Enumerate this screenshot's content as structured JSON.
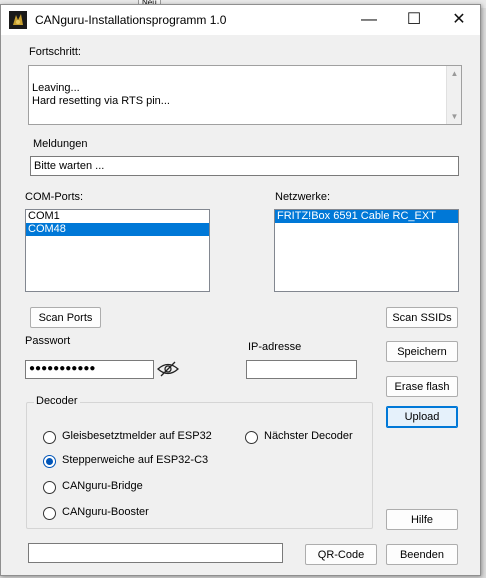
{
  "background_app": {
    "tab_label": "Neu"
  },
  "window": {
    "title": "CANguru-Installationsprogramm 1.0",
    "minimize_glyph": "—",
    "maximize_glyph": "☐",
    "close_glyph": "✕"
  },
  "progress": {
    "label": "Fortschritt:",
    "lines": [
      "Leaving...",
      "Hard resetting via RTS pin..."
    ]
  },
  "messages": {
    "label": "Meldungen",
    "value": "Bitte warten ..."
  },
  "com_ports": {
    "label": "COM-Ports:",
    "items": [
      "COM1",
      "COM48"
    ],
    "selected_index": 1,
    "scan_button": "Scan Ports"
  },
  "networks": {
    "label": "Netzwerke:",
    "items": [
      "FRITZ!Box 6591 Cable RC_EXT"
    ],
    "selected_index": 0,
    "scan_button": "Scan SSIDs"
  },
  "password": {
    "label": "Passwort",
    "masked_value": "●●●●●●●●●●●"
  },
  "ip": {
    "label": "IP-adresse",
    "value": ""
  },
  "decoder": {
    "label": "Decoder",
    "options": [
      "Gleisbesetztmelder auf ESP32",
      "Stepperweiche auf ESP32-C3",
      "CANguru-Bridge",
      "CANguru-Booster",
      "Nächster Decoder"
    ],
    "selected_option": "Stepperweiche auf ESP32-C3"
  },
  "buttons": {
    "save": "Speichern",
    "erase_flash": "Erase flash",
    "upload": "Upload",
    "help": "Hilfe",
    "qr_code": "QR-Code",
    "exit": "Beenden"
  },
  "bottom_field": {
    "value": ""
  },
  "colors": {
    "selection": "#0078d7",
    "window_bg": "#f0f0f0",
    "focus_border": "#0078d7"
  }
}
